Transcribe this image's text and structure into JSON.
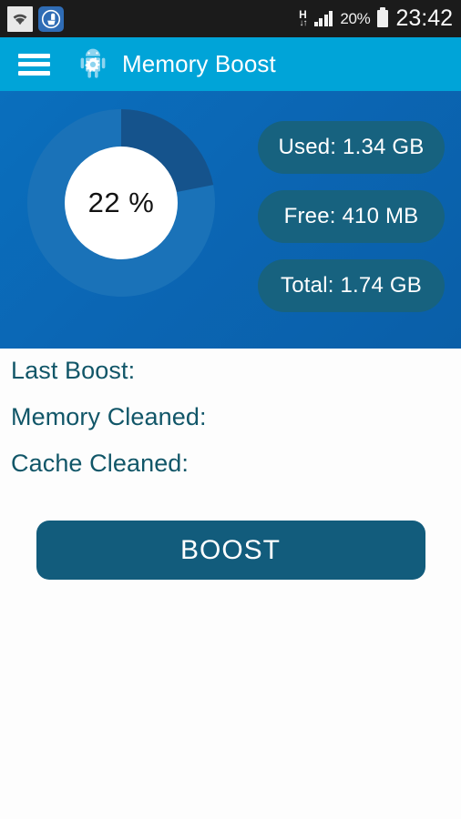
{
  "statusbar": {
    "wifi_icon": "wifi-icon",
    "app_notification_icon": "cleaner-app-icon",
    "network_type": "H",
    "network_arrows": "↓↑",
    "signal_icon": "signal-bars-icon",
    "battery_percent": "20%",
    "battery_icon": "battery-icon",
    "clock": "23:42"
  },
  "actionbar": {
    "menu_icon": "hamburger-menu-icon",
    "app_icon": "android-gear-icon",
    "title": "Memory Boost"
  },
  "dashboard": {
    "usage_percent_label": "22 %",
    "stats": [
      {
        "label": "Used: 1.34 GB"
      },
      {
        "label": "Free: 410 MB"
      },
      {
        "label": "Total: 1.74 GB"
      }
    ]
  },
  "info": {
    "rows": [
      {
        "label": "Last Boost:",
        "value": ""
      },
      {
        "label": "Memory Cleaned:",
        "value": ""
      },
      {
        "label": "Cache Cleaned:",
        "value": ""
      }
    ]
  },
  "actions": {
    "boost_label": "BOOST"
  },
  "colors": {
    "statusbar_bg": "#1b1b1b",
    "actionbar_bg": "#00a4d8",
    "panel_bg": "#0b66b4",
    "donut_used": "#15538c",
    "donut_free": "#1a72b8",
    "pill_bg": "#17627f",
    "info_text": "#115668",
    "boost_bg": "#125c7c"
  },
  "chart_data": {
    "type": "pie",
    "title": "Memory usage",
    "categories": [
      "Used",
      "Free"
    ],
    "values": [
      22,
      78
    ],
    "value_labels": [
      "1.34 GB",
      "410 MB"
    ],
    "total": "1.74 GB",
    "center_label": "22 %",
    "unit": "%",
    "colors": [
      "#15538c",
      "#1a72b8"
    ],
    "start_angle": 0,
    "direction": "clockwise",
    "donut": true,
    "legend": "right"
  }
}
